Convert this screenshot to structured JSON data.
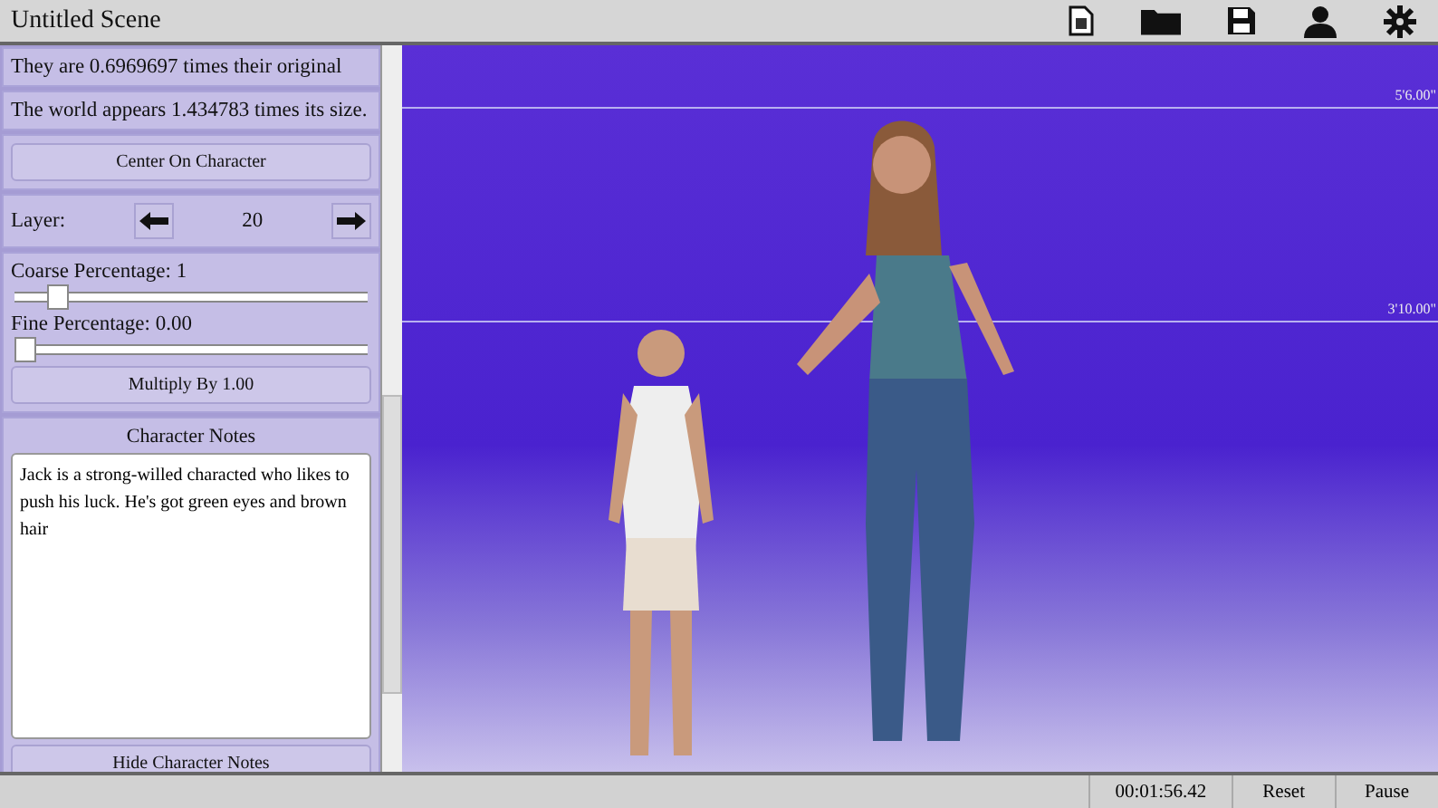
{
  "window": {
    "title": "Untitled Scene"
  },
  "toolbar": {
    "icons": [
      {
        "kind": "new"
      },
      {
        "kind": "open"
      },
      {
        "kind": "save"
      },
      {
        "kind": "person"
      },
      {
        "kind": "settings"
      }
    ]
  },
  "sidebar": {
    "scale_text": "They are 0.6969697 times their original",
    "world_text": "The world appears 1.434783 times its size.",
    "center_button": "Center On Character",
    "layer": {
      "label": "Layer:",
      "value": "20"
    },
    "sliders": [
      {
        "label": "Coarse Percentage: 1",
        "level": 0.1
      },
      {
        "label": "Fine Percentage: 0.00",
        "level": 0
      }
    ],
    "multiply_button": "Multiply By 1.00",
    "notes": {
      "title": "Character Notes",
      "value": "Jack is a strong-willed characted who likes to push his luck. He's got green eyes and brown hair"
    },
    "hide_notes_button": "Hide Character Notes"
  },
  "viewport": {
    "markers": [
      "5'6.00\"",
      "3'10.00\""
    ]
  },
  "status_bar": {
    "time": "00:01:56.42",
    "buttons": [
      "Reset",
      "Pause"
    ]
  }
}
